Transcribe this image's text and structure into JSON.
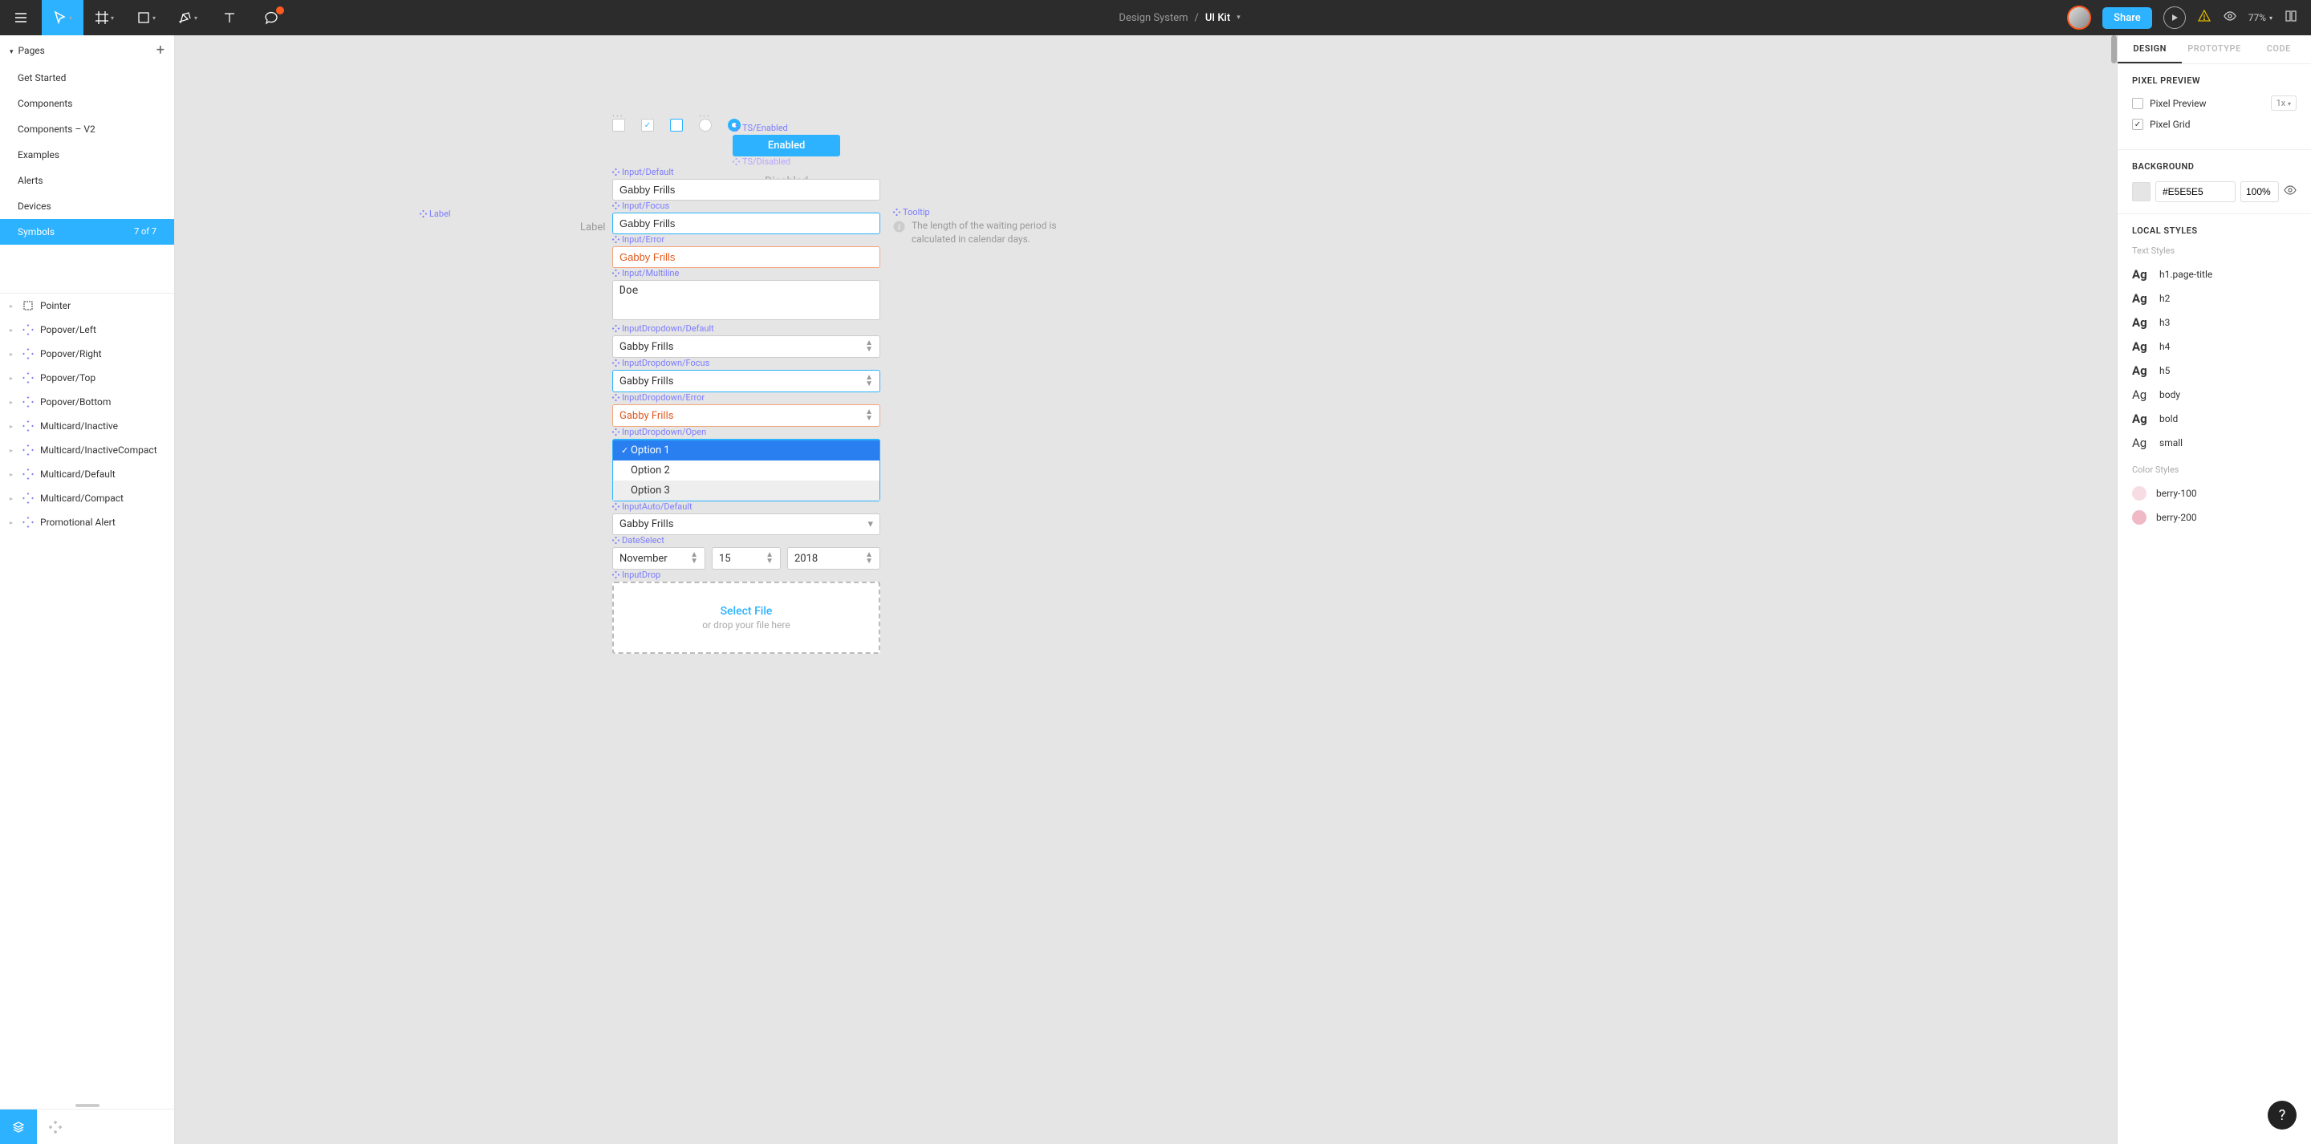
{
  "toolbar": {
    "breadcrumb_parent": "Design System",
    "breadcrumb_current": "UI Kit",
    "share_label": "Share",
    "zoom": "77%"
  },
  "left": {
    "pages_title": "Pages",
    "pages": [
      {
        "label": "Get Started"
      },
      {
        "label": "Components"
      },
      {
        "label": "Components – V2"
      },
      {
        "label": "Examples"
      },
      {
        "label": "Alerts"
      },
      {
        "label": "Devices"
      },
      {
        "label": "Symbols",
        "count": "7 of 7",
        "active": true
      }
    ],
    "layers": [
      {
        "label": "Pointer",
        "icon": "pointer"
      },
      {
        "label": "Popover/Left",
        "icon": "component"
      },
      {
        "label": "Popover/Right",
        "icon": "component"
      },
      {
        "label": "Popover/Top",
        "icon": "component"
      },
      {
        "label": "Popover/Bottom",
        "icon": "component"
      },
      {
        "label": "Multicard/Inactive",
        "icon": "component"
      },
      {
        "label": "Multicard/InactiveCompact",
        "icon": "component"
      },
      {
        "label": "Multicard/Default",
        "icon": "component"
      },
      {
        "label": "Multicard/Compact",
        "icon": "component"
      },
      {
        "label": "Promotional Alert",
        "icon": "component"
      }
    ]
  },
  "canvas": {
    "label_comp": "Label",
    "label_text": "Label",
    "ts_enabled_label": "TS/Enabled",
    "ts_enabled_btn": "Enabled",
    "ts_disabled_label": "TS/Disabled",
    "ts_disabled_text": "Disabled",
    "input_default_label": "Input/Default",
    "input_default_value": "Gabby Frills",
    "input_focus_label": "Input/Focus",
    "input_focus_value": "Gabby Frills",
    "input_error_label": "Input/Error",
    "input_error_value": "Gabby Frills",
    "input_multiline_label": "Input/Multiline",
    "input_multiline_value": "Doe",
    "dd_default_label": "InputDropdown/Default",
    "dd_default_value": "Gabby Frills",
    "dd_focus_label": "InputDropdown/Focus",
    "dd_focus_value": "Gabby Frills",
    "dd_error_label": "InputDropdown/Error",
    "dd_error_value": "Gabby Frills",
    "dd_open_label": "InputDropdown/Open",
    "dd_opt1": "Option 1",
    "dd_opt2": "Option 2",
    "dd_opt3": "Option 3",
    "auto_label": "InputAuto/Default",
    "auto_value": "Gabby Frills",
    "date_label": "DateSelect",
    "date_month": "November",
    "date_day": "15",
    "date_year": "2018",
    "drop_label": "InputDrop",
    "drop_select": "Select File",
    "drop_sub": "or drop your file here",
    "tooltip_label": "Tooltip",
    "tooltip_text": "The length of the waiting period is calculated in calendar days."
  },
  "right": {
    "tab_design": "DESIGN",
    "tab_proto": "PROTOTYPE",
    "tab_code": "CODE",
    "pixel_preview_title": "PIXEL PREVIEW",
    "pixel_preview_label": "Pixel Preview",
    "pixel_scale": "1x",
    "pixel_grid_label": "Pixel Grid",
    "background_title": "BACKGROUND",
    "bg_hex": "#E5E5E5",
    "bg_opacity": "100%",
    "local_styles_title": "LOCAL STYLES",
    "text_styles_sub": "Text Styles",
    "text_styles": [
      {
        "name": "h1.page-title",
        "bold": true
      },
      {
        "name": "h2",
        "bold": true
      },
      {
        "name": "h3",
        "bold": true
      },
      {
        "name": "h4",
        "bold": true
      },
      {
        "name": "h5",
        "bold": true
      },
      {
        "name": "body",
        "bold": false
      },
      {
        "name": "bold",
        "bold": true
      },
      {
        "name": "small",
        "bold": false
      }
    ],
    "color_styles_sub": "Color Styles",
    "color_styles": [
      {
        "name": "berry-100",
        "hex": "#f8dce3"
      },
      {
        "name": "berry-200",
        "hex": "#f0b9c6"
      }
    ]
  }
}
